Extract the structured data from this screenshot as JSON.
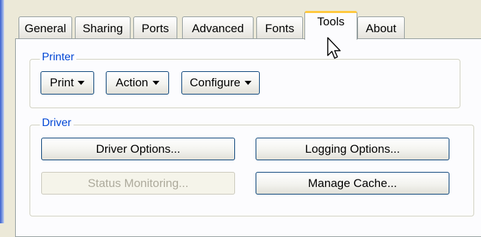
{
  "tabs": [
    {
      "label": "General"
    },
    {
      "label": "Sharing"
    },
    {
      "label": "Ports"
    },
    {
      "label": "Advanced"
    },
    {
      "label": "Fonts"
    },
    {
      "label": "Tools"
    },
    {
      "label": "About"
    }
  ],
  "active_tab": "Tools",
  "printer_group": {
    "title": "Printer",
    "buttons": [
      {
        "label": "Print"
      },
      {
        "label": "Action"
      },
      {
        "label": "Configure"
      }
    ]
  },
  "driver_group": {
    "title": "Driver",
    "driver_options": "Driver Options...",
    "logging_options": "Logging Options...",
    "status_monitoring": "Status Monitoring...",
    "manage_cache": "Manage Cache..."
  },
  "colors": {
    "window_bg": "#ECE9D8",
    "panel_bg": "#FCFCFE",
    "group_title": "#0046D5",
    "active_tab_accent": "#FFC83C",
    "button_border": "#003C74",
    "disabled_text": "#ADAA9C"
  },
  "icons": {
    "dropdown": "caret-down-icon",
    "pointer": "mouse-pointer-icon"
  }
}
